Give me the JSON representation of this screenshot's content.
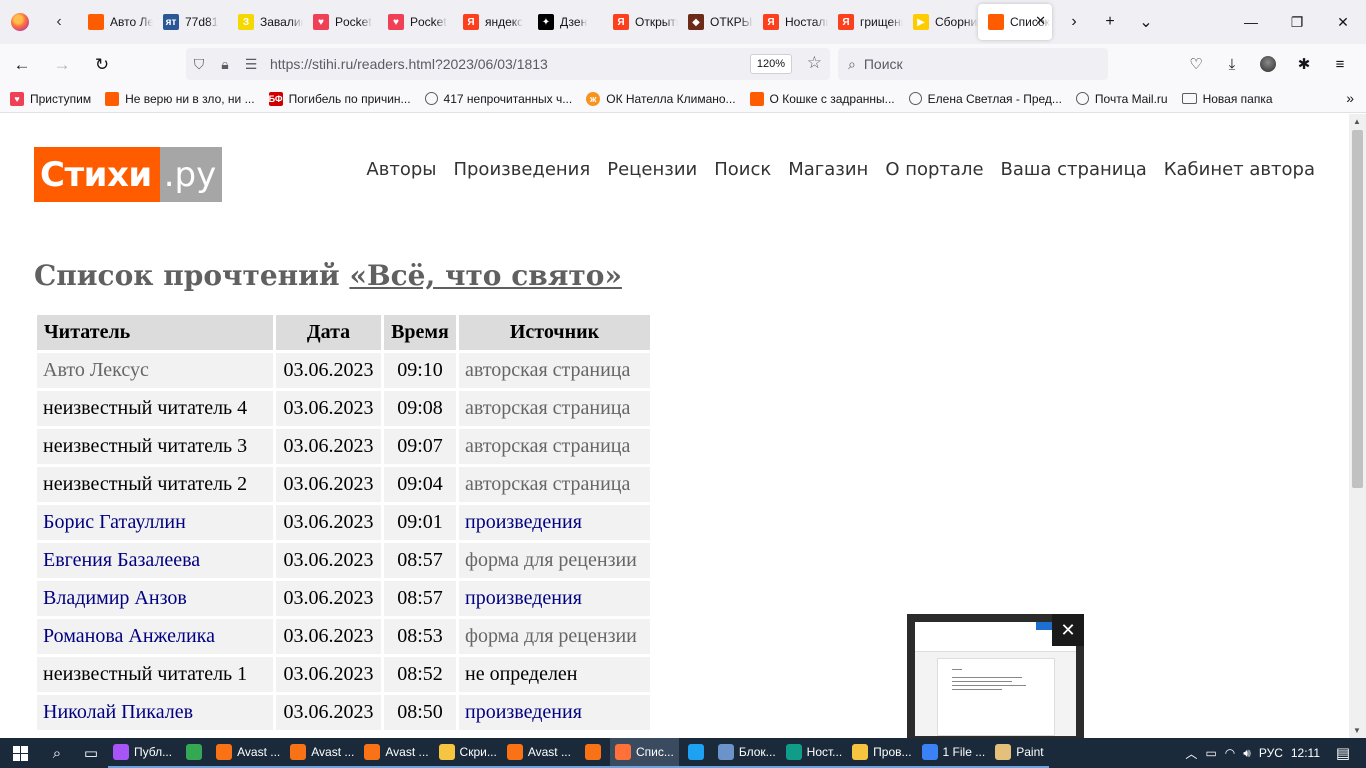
{
  "browser": {
    "tabs": [
      {
        "label": "Авто Лексус",
        "color": "#ff5c00",
        "glyph": ""
      },
      {
        "label": "77d81",
        "color": "#2b5797",
        "glyph": "ят"
      },
      {
        "label": "Завалинка",
        "color": "#f5d800",
        "glyph": "З"
      },
      {
        "label": "Pocket",
        "color": "#ef4056",
        "glyph": "♥"
      },
      {
        "label": "Pocket",
        "color": "#ef4056",
        "glyph": "♥"
      },
      {
        "label": "яндекс",
        "color": "#fc3f1d",
        "glyph": "Я"
      },
      {
        "label": "Дзен",
        "color": "#000000",
        "glyph": "✦"
      },
      {
        "label": "Открытки",
        "color": "#fc3f1d",
        "glyph": "Я"
      },
      {
        "label": "ОТКРЫТКИ",
        "color": "#6b2a1a",
        "glyph": "◆"
      },
      {
        "label": "Ностальгия",
        "color": "#fc3f1d",
        "glyph": "Я"
      },
      {
        "label": "грищенко",
        "color": "#fc3f1d",
        "glyph": "Я"
      },
      {
        "label": "Сборник",
        "color": "#ffcc00",
        "glyph": "▶"
      },
      {
        "label": "Список",
        "color": "#ff5c00",
        "glyph": "",
        "active": true
      }
    ],
    "url": "https://stihi.ru/readers.html?2023/06/03/1813",
    "zoom": "120%",
    "search_placeholder": "Поиск",
    "bookmarks": [
      {
        "label": "Приступим",
        "type": "pocket",
        "color": "#ef4056"
      },
      {
        "label": "Не верю ни в зло, ни ...",
        "type": "square",
        "color": "#ff5c00"
      },
      {
        "label": "Погибель по причин...",
        "type": "bf",
        "color": "#d10000"
      },
      {
        "label": "417 непрочитанных ч...",
        "type": "globe",
        "color": ""
      },
      {
        "label": "ОК Нателла Климано...",
        "type": "ok",
        "color": "#f7931e"
      },
      {
        "label": "О Кошке с задранны...",
        "type": "square",
        "color": "#ff5c00"
      },
      {
        "label": "Елена Светлая - Пред...",
        "type": "globe",
        "color": ""
      },
      {
        "label": "Почта Mail.ru",
        "type": "globe",
        "color": ""
      },
      {
        "label": "Новая папка",
        "type": "folder",
        "color": ""
      }
    ]
  },
  "site": {
    "logo_left": "Стихи",
    "logo_right": ".ру",
    "menu": [
      "Авторы",
      "Произведения",
      "Рецензии",
      "Поиск",
      "Магазин",
      "О портале",
      "Ваша страница",
      "Кабинет автора"
    ],
    "title_prefix": "Список прочтений ",
    "title_work": "«Всё, что свято»",
    "table": {
      "headers": [
        "Читатель",
        "Дата",
        "Время",
        "Источник"
      ],
      "rows": [
        {
          "reader": "Авто Лексус",
          "reader_style": "gray",
          "date": "03.06.2023",
          "time": "09:10",
          "source": "авторская страница",
          "source_style": "gray"
        },
        {
          "reader": "неизвестный читатель 4",
          "reader_style": "plain",
          "date": "03.06.2023",
          "time": "09:08",
          "source": "авторская страница",
          "source_style": "gray"
        },
        {
          "reader": "неизвестный читатель 3",
          "reader_style": "plain",
          "date": "03.06.2023",
          "time": "09:07",
          "source": "авторская страница",
          "source_style": "gray"
        },
        {
          "reader": "неизвестный читатель 2",
          "reader_style": "plain",
          "date": "03.06.2023",
          "time": "09:04",
          "source": "авторская страница",
          "source_style": "gray"
        },
        {
          "reader": "Борис Гатауллин",
          "reader_style": "link",
          "date": "03.06.2023",
          "time": "09:01",
          "source": "произведения",
          "source_style": "link"
        },
        {
          "reader": "Евгения Базалеева",
          "reader_style": "link",
          "date": "03.06.2023",
          "time": "08:57",
          "source": "форма для рецензии",
          "source_style": "gray"
        },
        {
          "reader": "Владимир Анзов",
          "reader_style": "link",
          "date": "03.06.2023",
          "time": "08:57",
          "source": "произведения",
          "source_style": "link"
        },
        {
          "reader": "Романова Анжелика",
          "reader_style": "link",
          "date": "03.06.2023",
          "time": "08:53",
          "source": "форма для рецензии",
          "source_style": "gray"
        },
        {
          "reader": "неизвестный читатель 1",
          "reader_style": "plain",
          "date": "03.06.2023",
          "time": "08:52",
          "source": "не определен",
          "source_style": "plain"
        },
        {
          "reader": "Николай Пикалев",
          "reader_style": "link",
          "date": "03.06.2023",
          "time": "08:50",
          "source": "произведения",
          "source_style": "link"
        }
      ]
    }
  },
  "taskbar": {
    "items": [
      {
        "label": "Публ...",
        "color": "#a855f7"
      },
      {
        "label": "",
        "color": "#34a853",
        "icon_only": true
      },
      {
        "label": "Avast ...",
        "color": "#f97316"
      },
      {
        "label": "Avast ...",
        "color": "#f97316"
      },
      {
        "label": "Avast ...",
        "color": "#f97316"
      },
      {
        "label": "Скри...",
        "color": "#f5c542"
      },
      {
        "label": "Avast ...",
        "color": "#f97316"
      },
      {
        "label": "",
        "color": "#f97316",
        "icon_only": true
      },
      {
        "label": "Спис...",
        "color": "#ff7139",
        "active": true
      },
      {
        "label": "",
        "color": "#1da1f2",
        "icon_only": true
      },
      {
        "label": "Блок...",
        "color": "#6b93c9"
      },
      {
        "label": "Ност...",
        "color": "#0f9d8a"
      },
      {
        "label": "Пров...",
        "color": "#f5c542"
      },
      {
        "label": "1 File ...",
        "color": "#3b82f6"
      },
      {
        "label": "Paint",
        "color": "#e5c07b"
      }
    ],
    "language": "РУС",
    "time": "12:11"
  }
}
